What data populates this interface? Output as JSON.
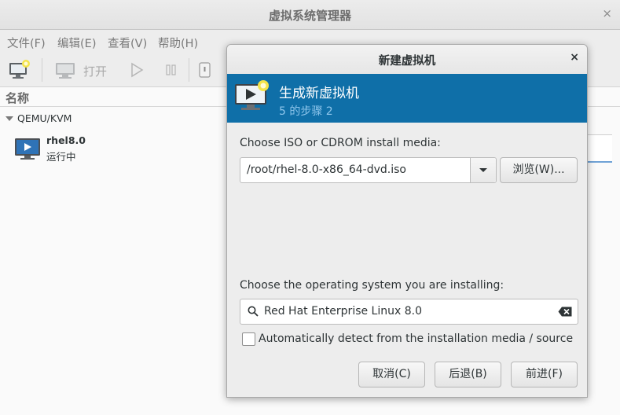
{
  "main_window": {
    "title": "虚拟系统管理器",
    "close_symbol": "×",
    "menu": [
      "文件(F)",
      "编辑(E)",
      "查看(V)",
      "帮助(H)"
    ],
    "toolbar": {
      "open_label": "打开"
    },
    "column_header": "名称",
    "connection": "QEMU/KVM",
    "vm": {
      "name": "rhel8.0",
      "status": "运行中"
    }
  },
  "dialog": {
    "title": "新建虚拟机",
    "close_symbol": "×",
    "banner_title": "生成新虚拟机",
    "banner_step": "5 的步骤 2",
    "media_label": "Choose ISO or CDROM install media:",
    "media_value": "/root/rhel-8.0-x86_64-dvd.iso",
    "browse_label": "浏览(W)...",
    "os_label": "Choose the operating system you are installing:",
    "os_value": "Red Hat Enterprise Linux 8.0",
    "auto_detect_label": "Automatically detect from the installation media / source",
    "auto_detect_checked": false,
    "buttons": {
      "cancel": "取消(C)",
      "back": "后退(B)",
      "forward": "前进(F)"
    }
  },
  "colors": {
    "banner": "#0f6fa8",
    "banner_step": "#8ec6ec",
    "vm_icon_blue": "#2f73b7"
  },
  "icons": [
    "new-vm-icon",
    "monitor-icon",
    "play-icon",
    "pause-icon",
    "shutdown-icon",
    "vm-monitor-icon",
    "search-icon",
    "clear-icon",
    "dropdown-arrow-icon"
  ]
}
